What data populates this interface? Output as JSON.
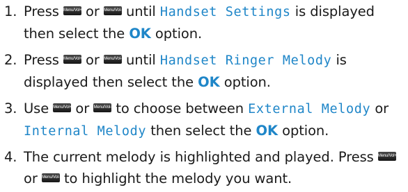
{
  "keys": {
    "up": "Menu/Vol+",
    "down": "Menu/Vol-"
  },
  "common": {
    "or": "or",
    "ok": "OK",
    "option_end": "option."
  },
  "steps": [
    {
      "number": "1.",
      "press": "Press",
      "until": "until",
      "lcd_text": "Handset Settings",
      "after": "is displayed then select the"
    },
    {
      "number": "2.",
      "press": "Press",
      "until": "until",
      "lcd_text": "Handset Ringer Melody",
      "after": "is displayed then select the"
    },
    {
      "number": "3.",
      "use": "Use",
      "to_choose": "to choose between",
      "lcd_external": "External Melody",
      "lcd_internal": "Internal Melody",
      "after": "then select the"
    },
    {
      "number": "4.",
      "text": "The current melody is highlighted and played. Press",
      "to_highlight": "to highlight the melody you want."
    }
  ]
}
